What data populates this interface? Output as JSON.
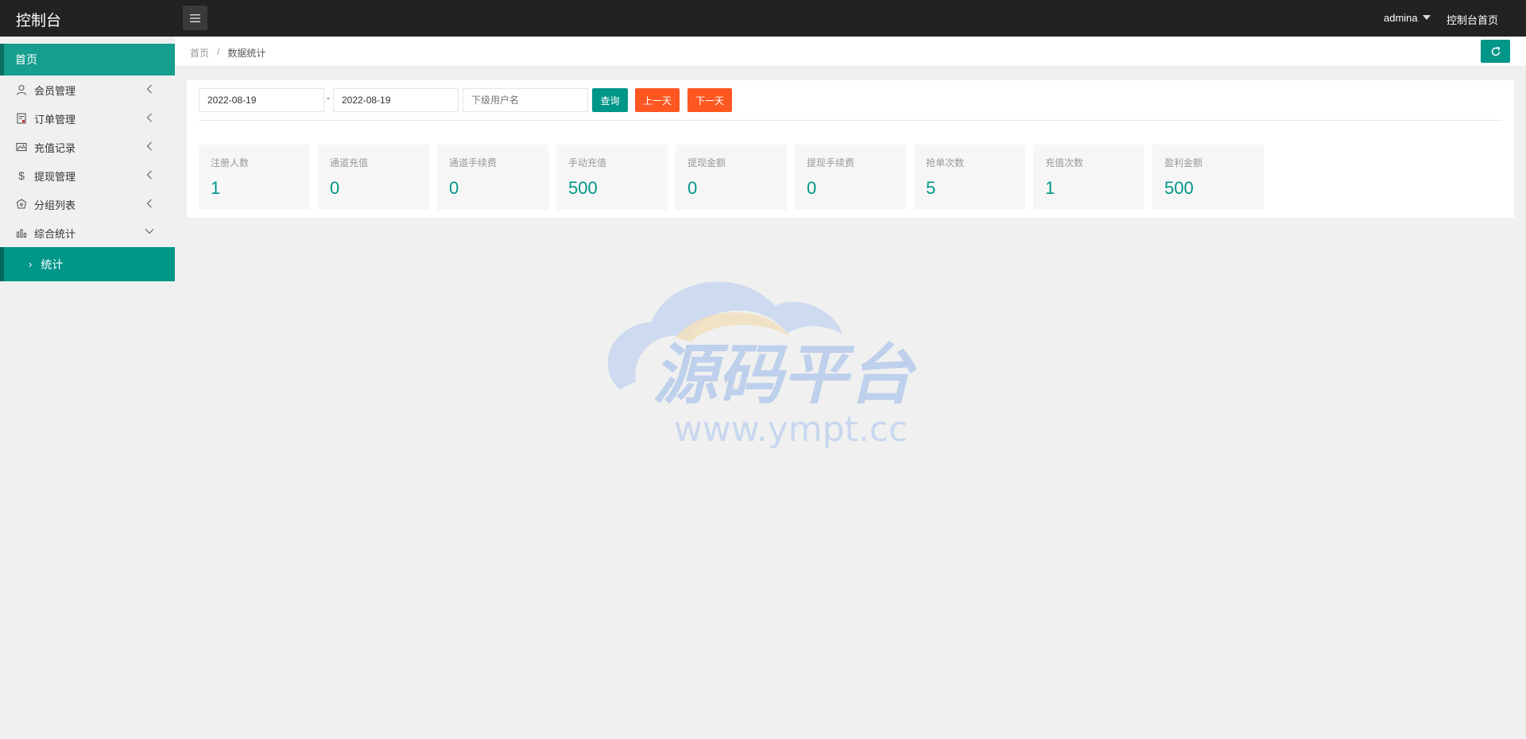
{
  "header": {
    "title": "控制台",
    "user": "admina",
    "home_link": "控制台首页"
  },
  "sidebar": {
    "home": "首页",
    "items": [
      {
        "label": "会员管理",
        "icon": "user-icon"
      },
      {
        "label": "订单管理",
        "icon": "order-icon"
      },
      {
        "label": "充值记录",
        "icon": "image-icon"
      },
      {
        "label": "提现管理",
        "icon": "dollar-icon"
      },
      {
        "label": "分组列表",
        "icon": "group-icon"
      },
      {
        "label": "综合统计",
        "icon": "chart-icon"
      }
    ],
    "sub_active": "统计"
  },
  "breadcrumb": {
    "home": "首页",
    "separator": "/",
    "current": "数据统计"
  },
  "filters": {
    "start_date": "2022-08-19",
    "end_date": "2022-08-19",
    "dash": "-",
    "username_placeholder": "下级用户名",
    "query_label": "查询",
    "prev_label": "上一天",
    "next_label": "下一天"
  },
  "stats": [
    {
      "label": "注册人数",
      "value": "1"
    },
    {
      "label": "通道充值",
      "value": "0"
    },
    {
      "label": "通道手续费",
      "value": "0"
    },
    {
      "label": "手动充值",
      "value": "500"
    },
    {
      "label": "提现金额",
      "value": "0"
    },
    {
      "label": "提现手续费",
      "value": "0"
    },
    {
      "label": "抢单次数",
      "value": "5"
    },
    {
      "label": "充值次数",
      "value": "1"
    },
    {
      "label": "盈利金额",
      "value": "500"
    }
  ],
  "watermark": {
    "title": "源码平台",
    "url": "www.ympt.cc"
  },
  "colors": {
    "primary": "#009688",
    "warm": "#ff5722",
    "topbar": "#222222"
  }
}
